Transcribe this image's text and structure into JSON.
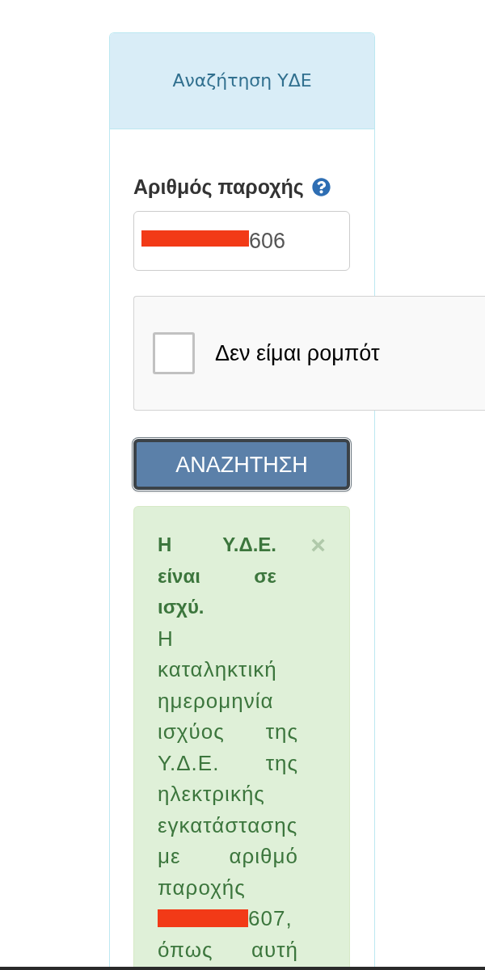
{
  "panel": {
    "title": "Αναζήτηση ΥΔΕ"
  },
  "field": {
    "label": "Αριθμός παροχής",
    "value": "606",
    "redacted": true
  },
  "captcha": {
    "label": "Δεν είμαι ρομπότ",
    "checked": false
  },
  "button": {
    "label": "ΑΝΑΖΗΤΗΣΗ",
    "focused": true
  },
  "alert": {
    "kind": "success",
    "heading": "Η Υ.Δ.Ε. είναι σε ισχύ.",
    "close": "×",
    "body": [
      {
        "kind": "text",
        "text": "Η καταληκτική ημερομηνία ισχύος της Υ.Δ.Ε. της ηλεκτρικής εγκατάστασης με αριθμό παροχής"
      },
      {
        "kind": "redaction"
      },
      {
        "kind": "text",
        "text": "607,"
      },
      {
        "kind": "text",
        "text": "όπως αυτή"
      }
    ]
  }
}
